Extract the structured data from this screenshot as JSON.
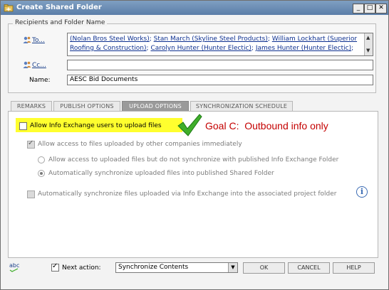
{
  "window": {
    "title": "Create Shared Folder",
    "min_symbol": "_",
    "max_symbol": "□",
    "close_symbol": "✕"
  },
  "recipients": {
    "group_title": "Recipients and Folder Name",
    "to_label": "To...",
    "to_recipients": [
      "(Nolan Bros Steel Works)",
      "Stan March (Skyline Steel Products)",
      "William Lockhart (Superior Roofing & Construction)",
      "Carolyn Hunter (Hunter Electic)",
      "James Hunter (Hunter Electic)"
    ],
    "separator": ";",
    "cc_label": "Cc...",
    "cc_value": "",
    "name_label": "Name:",
    "name_value": "AESC Bid Documents"
  },
  "tabs": [
    {
      "label": "REMARKS",
      "active": false
    },
    {
      "label": "PUBLISH OPTIONS",
      "active": false
    },
    {
      "label": "UPLOAD OPTIONS",
      "active": true
    },
    {
      "label": "SYNCHRONIZATION SCHEDULE",
      "active": false
    }
  ],
  "upload_options": {
    "allow_upload": {
      "label": "Allow Info Exchange users to upload files",
      "checked": false
    },
    "allow_access": {
      "label": "Allow access to files uploaded by other companies immediately",
      "checked": true,
      "enabled": false
    },
    "radio_no_sync": {
      "label": "Allow access to uploaded files but do not synchronize with published Info Exchange Folder",
      "selected": false
    },
    "radio_auto_sync": {
      "label": "Automatically synchronize uploaded files into published Shared Folder",
      "selected": true
    },
    "auto_sync_project": {
      "label": "Automatically synchronize files uploaded via Info Exchange into the associated project folder",
      "checked": false,
      "enabled": false
    },
    "annotation": "Goal C:  Outbound info only",
    "annotation_color": "#c40000",
    "highlight_color": "#ffff2e",
    "info_icon": "i"
  },
  "footer": {
    "spellcheck_icon": "abc",
    "next_action_label": "Next action:",
    "next_action_checked": true,
    "next_action_value": "Synchronize Contents",
    "ok_label": "OK",
    "cancel_label": "CANCEL",
    "help_label": "HELP"
  }
}
